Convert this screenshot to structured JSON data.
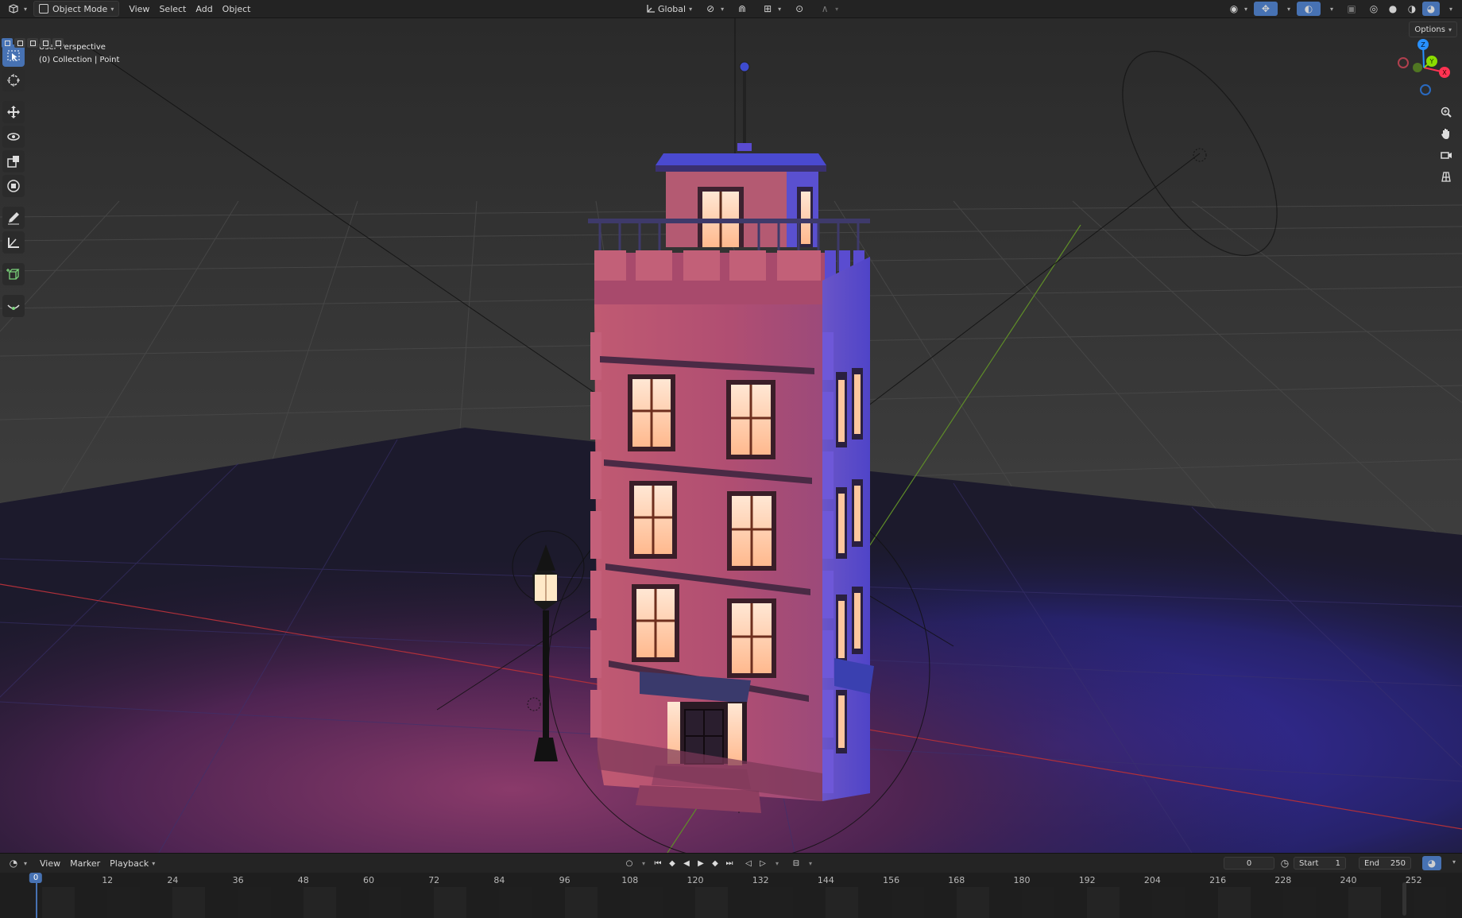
{
  "header": {
    "editor_type_icon": "3d-viewport-icon",
    "mode": "Object Mode",
    "menus": [
      "View",
      "Select",
      "Add",
      "Object"
    ],
    "transform_orientation": "Global",
    "options_label": "Options"
  },
  "viewport": {
    "view_name": "User Perspective",
    "collection_info": "(0) Collection | Point",
    "gizmo": {
      "x": "X",
      "y": "Y",
      "z": "Z"
    },
    "colors": {
      "x_axis": "#ff3352",
      "y_axis": "#8bdc00",
      "z_axis": "#2890ff",
      "active_tool": "#4772b3"
    }
  },
  "toolbar": {
    "tools": [
      "select-box",
      "cursor",
      "move",
      "rotate",
      "scale",
      "transform",
      "annotate",
      "measure",
      "add-cube",
      "loop-cut"
    ]
  },
  "timeline": {
    "menus": [
      "View",
      "Marker",
      "Playback"
    ],
    "current_frame": "0",
    "start_label": "Start",
    "start_value": "1",
    "end_label": "End",
    "end_value": "250",
    "ruler": [
      "0",
      "12",
      "24",
      "36",
      "48",
      "60",
      "72",
      "84",
      "96",
      "108",
      "120",
      "132",
      "144",
      "156",
      "168",
      "180",
      "192",
      "204",
      "216",
      "228",
      "240",
      "252"
    ]
  }
}
